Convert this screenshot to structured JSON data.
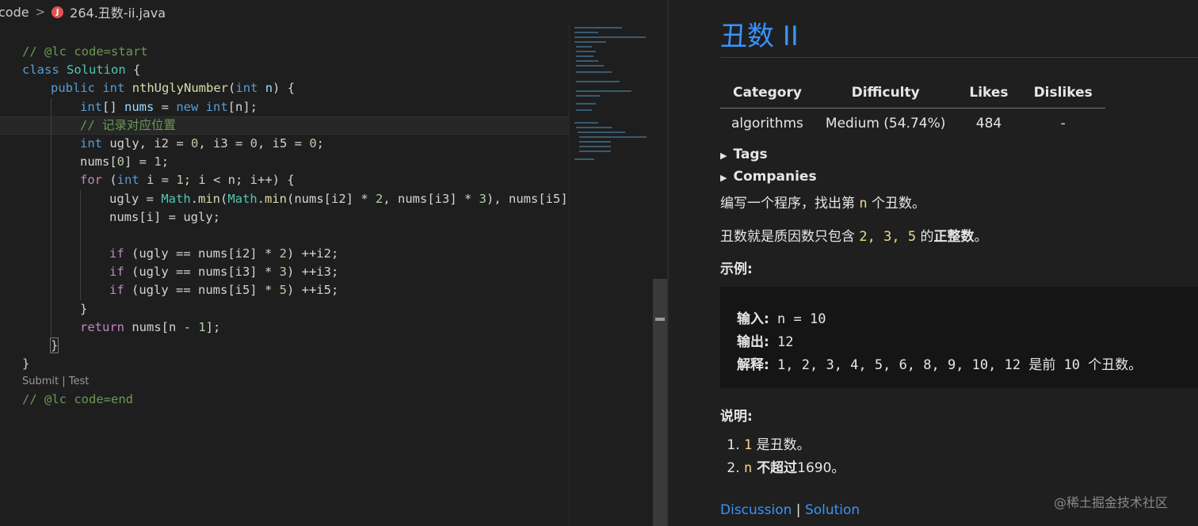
{
  "breadcrumb": {
    "folder": "code",
    "separator": ">",
    "file_icon": "J",
    "file": "264.丑数-ii.java"
  },
  "code": {
    "l1": "// @lc code=start",
    "l2_kw": "class",
    "l2_name": "Solution",
    "l2_brace": " {",
    "l3_pub": "public",
    "l3_int": "int",
    "l3_fn": "nthUglyNumber",
    "l3_p1": "(",
    "l3_int2": "int",
    "l3_n": "n",
    "l3_p2": ") {",
    "l4_int": "int",
    "l4_a": "[] ",
    "l4_nums": "nums",
    "l4_b": " = ",
    "l4_new": "new",
    "l4_int2": "int",
    "l4_c": "[n];",
    "l5_comment": "// 记录对应位置",
    "l6_int": "int",
    "l6_rest": " ugly, i2 = ",
    "l6_z1": "0",
    "l6_r2": ", i3 = ",
    "l6_z2": "0",
    "l6_r3": ", i5 = ",
    "l6_z3": "0",
    "l6_end": ";",
    "l7_a": "nums[",
    "l7_z": "0",
    "l7_b": "] = ",
    "l7_one": "1",
    "l7_c": ";",
    "l8_for": "for",
    "l8_a": " (",
    "l8_int": "int",
    "l8_b": " i = ",
    "l8_one": "1",
    "l8_c": "; i < n; i++) {",
    "l9_a": "ugly = ",
    "l9_math": "Math",
    "l9_dot": ".",
    "l9_min": "min",
    "l9_b": "(",
    "l9_math2": "Math",
    "l9_dot2": ".",
    "l9_min2": "min",
    "l9_c": "(nums[i2] * ",
    "l9_two": "2",
    "l9_d": ", nums[i3] * ",
    "l9_three": "3",
    "l9_e": "), nums[i5]",
    "l10": "nums[i] = ugly;",
    "l12_if": "if",
    "l12_a": " (ugly == nums[i2] * ",
    "l12_n": "2",
    "l12_b": ") ++i2;",
    "l13_if": "if",
    "l13_a": " (ugly == nums[i3] * ",
    "l13_n": "3",
    "l13_b": ") ++i3;",
    "l14_if": "if",
    "l14_a": " (ugly == nums[i5] * ",
    "l14_n": "5",
    "l14_b": ") ++i5;",
    "l15": "}",
    "l16_ret": "return",
    "l16_a": " nums[n - ",
    "l16_one": "1",
    "l16_b": "];",
    "l17": "}",
    "l18": "}",
    "codelens": "Submit | Test",
    "l19": "// @lc code=end"
  },
  "problem": {
    "title": "丑数 II",
    "table": {
      "headers": [
        "Category",
        "Difficulty",
        "Likes",
        "Dislikes"
      ],
      "row": [
        "algorithms",
        "Medium (54.74%)",
        "484",
        "-"
      ]
    },
    "tags_label": "Tags",
    "companies_label": "Companies",
    "desc1_a": "编写一个程序，找出第 ",
    "desc1_n": "n",
    "desc1_b": " 个丑数。",
    "desc2_a": "丑数就是质因数只包含 ",
    "desc2_nums": "2, 3, 5",
    "desc2_b": " 的",
    "desc2_bold": "正整数",
    "desc2_c": "。",
    "example_label": "示例:",
    "example": {
      "in_label": "输入:",
      "in_val": " n = 10",
      "out_label": "输出:",
      "out_val": " 12",
      "exp_label": "解释:",
      "exp_val": " 1, 2, 3, 4, 5, 6, 8, 9, 10, 12 是前 10 个丑数。"
    },
    "notes_label": "说明:",
    "note1_code": "1",
    "note1_text": " 是丑数。",
    "note2_code": "n",
    "note2_bold": " 不超过",
    "note2_text": "1690。",
    "link_discussion": "Discussion",
    "link_sep": " | ",
    "link_solution": "Solution"
  },
  "watermark": "@稀土掘金技术社区"
}
